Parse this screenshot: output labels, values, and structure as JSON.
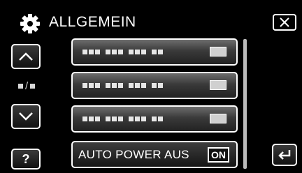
{
  "header": {
    "title": "ALLGEMEIN",
    "icon": "gear-icon"
  },
  "left_nav": {
    "help_label": "?",
    "page_separator": "/"
  },
  "menu": {
    "items": [
      {
        "label": "",
        "placeholder": true
      },
      {
        "label": "",
        "placeholder": true
      },
      {
        "label": "",
        "placeholder": true
      },
      {
        "label": "AUTO POWER AUS",
        "value": "ON"
      }
    ]
  },
  "colors": {
    "background": "#000000",
    "button_border": "#ffffff"
  }
}
